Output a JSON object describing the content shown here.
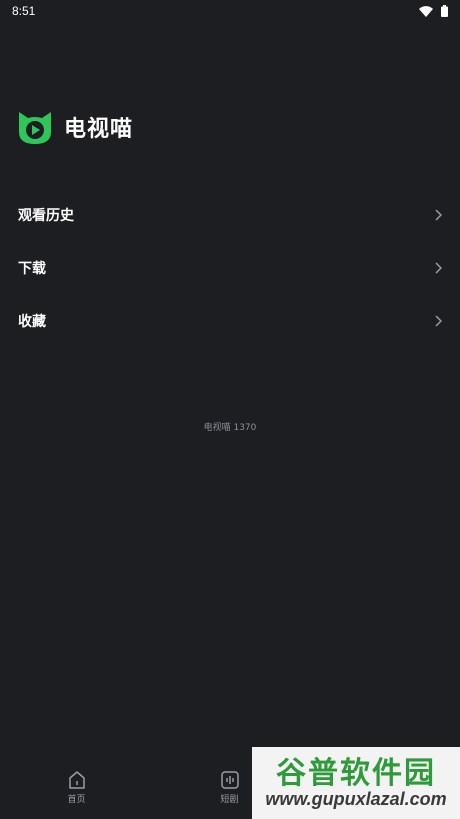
{
  "status_bar": {
    "time": "8:51",
    "icons": [
      "wifi-icon",
      "battery-icon"
    ]
  },
  "brand": {
    "name": "电视喵",
    "logo_icon": "cat-play-logo",
    "accent_color": "#2ec659"
  },
  "menu": {
    "items": [
      {
        "label": "观看历史",
        "icon": "chevron-right-icon"
      },
      {
        "label": "下载",
        "icon": "chevron-right-icon"
      },
      {
        "label": "收藏",
        "icon": "chevron-right-icon"
      }
    ]
  },
  "version_text": "电视喵 1370",
  "bottom_nav": {
    "tabs": [
      {
        "label": "首页",
        "icon": "home-icon"
      },
      {
        "label": "短剧",
        "icon": "short-drama-icon"
      }
    ]
  },
  "watermark": {
    "title": "谷普软件园",
    "url": "www.gupuxlazal.com"
  },
  "colors": {
    "background": "#1c1e22",
    "text_primary": "#ffffff",
    "text_secondary": "#8c8f95"
  }
}
